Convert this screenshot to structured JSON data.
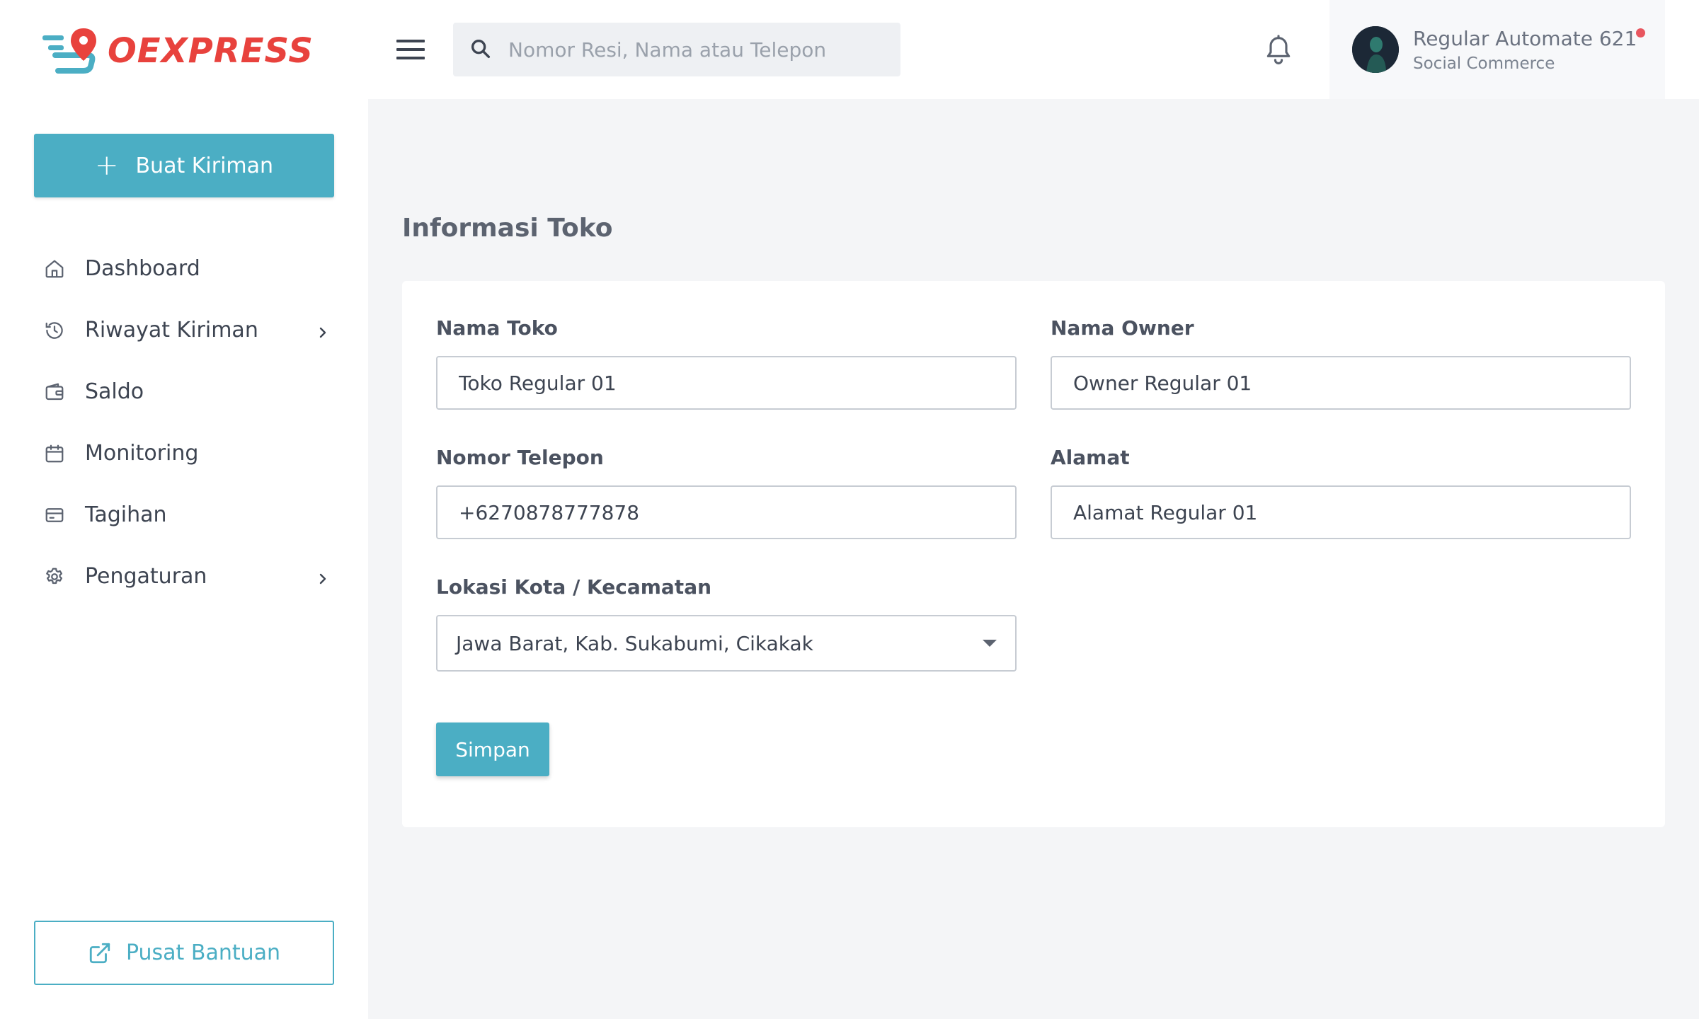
{
  "brand": {
    "name": "OEXPRESS",
    "color": "#e8423d"
  },
  "sidebar": {
    "create_button": {
      "label": "Buat Kiriman",
      "icon": "plus-icon"
    },
    "items": [
      {
        "label": "Dashboard",
        "icon": "home-icon",
        "has_submenu": false
      },
      {
        "label": "Riwayat Kiriman",
        "icon": "history-icon",
        "has_submenu": true
      },
      {
        "label": "Saldo",
        "icon": "wallet-icon",
        "has_submenu": false
      },
      {
        "label": "Monitoring",
        "icon": "calendar-icon",
        "has_submenu": false
      },
      {
        "label": "Tagihan",
        "icon": "credit-card-icon",
        "has_submenu": false
      },
      {
        "label": "Pengaturan",
        "icon": "gear-icon",
        "has_submenu": true
      }
    ],
    "help_button": {
      "label": "Pusat Bantuan",
      "icon": "external-link-icon"
    }
  },
  "header": {
    "search": {
      "placeholder": "Nomor Resi, Nama atau Telepon",
      "value": ""
    },
    "user": {
      "name": "Regular Automate 621",
      "role": "Social Commerce",
      "has_notification_dot": true
    }
  },
  "main": {
    "title": "Informasi Toko",
    "form": {
      "store_name": {
        "label": "Nama Toko",
        "value": "Toko Regular 01"
      },
      "owner_name": {
        "label": "Nama Owner",
        "value": "Owner Regular 01"
      },
      "phone": {
        "label": "Nomor Telepon",
        "value": "+6270878777878"
      },
      "address": {
        "label": "Alamat",
        "value": "Alamat Regular 01"
      },
      "location": {
        "label": "Lokasi Kota / Kecamatan",
        "value": "Jawa Barat, Kab. Sukabumi, Cikakak"
      },
      "save_label": "Simpan"
    }
  },
  "colors": {
    "accent": "#4baec4",
    "brand_red": "#e8423d",
    "background": "#f4f5f7"
  }
}
